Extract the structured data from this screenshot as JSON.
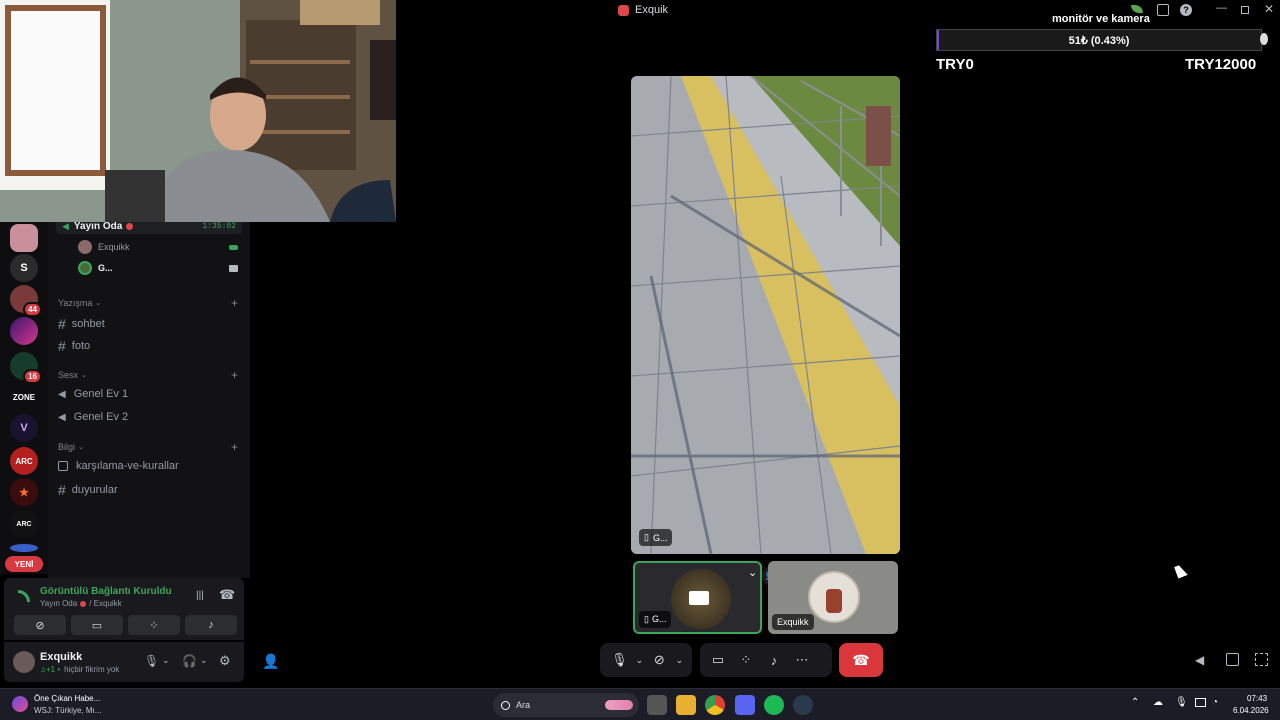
{
  "window": {
    "title": "Exquik"
  },
  "stream_overlay": {
    "label": "monitör ve kamera",
    "donation_progress": "51₺ (0.43%)",
    "progress_fraction": 0.0043,
    "goal_min": "TRY0",
    "goal_max": "TRY12000"
  },
  "sidebar": {
    "voice_channel": {
      "name": "Yayın Oda",
      "timer": "1:35:02"
    },
    "members": [
      {
        "name": "Exquikk"
      },
      {
        "name": "G..."
      }
    ],
    "categories": [
      {
        "name": "Yazışma",
        "channels": [
          "sohbet",
          "foto"
        ]
      },
      {
        "name": "Sesx",
        "channels": [
          "Genel Ev 1",
          "Genel Ev 2"
        ]
      },
      {
        "name": "Bilgi",
        "channels": [
          "karşılama-ve-kurallar",
          "duyurular"
        ]
      }
    ]
  },
  "rail": {
    "badges": [
      "44",
      "16"
    ],
    "new_label": "YENİ",
    "labels": {
      "s": "S",
      "zone": "ZONE",
      "arc": "ARC"
    }
  },
  "voice_panel": {
    "status": "Görüntülü Bağlantı Kuruldu",
    "location": "Yayın Oda",
    "location_suffix": "/ Exquikk"
  },
  "user_panel": {
    "name": "Exquikk",
    "status": "hiçbir fikrim yok"
  },
  "stream": {
    "main_label": "G...",
    "tile1_label": "G...",
    "tile2_label": "Exquikk"
  },
  "taskbar": {
    "news_title": "Öne Çıkan Habe...",
    "news_sub": "WSJ: Türkiye, Mı...",
    "search_placeholder": "Ara",
    "time": "07:43",
    "date": "6.04.2026"
  }
}
